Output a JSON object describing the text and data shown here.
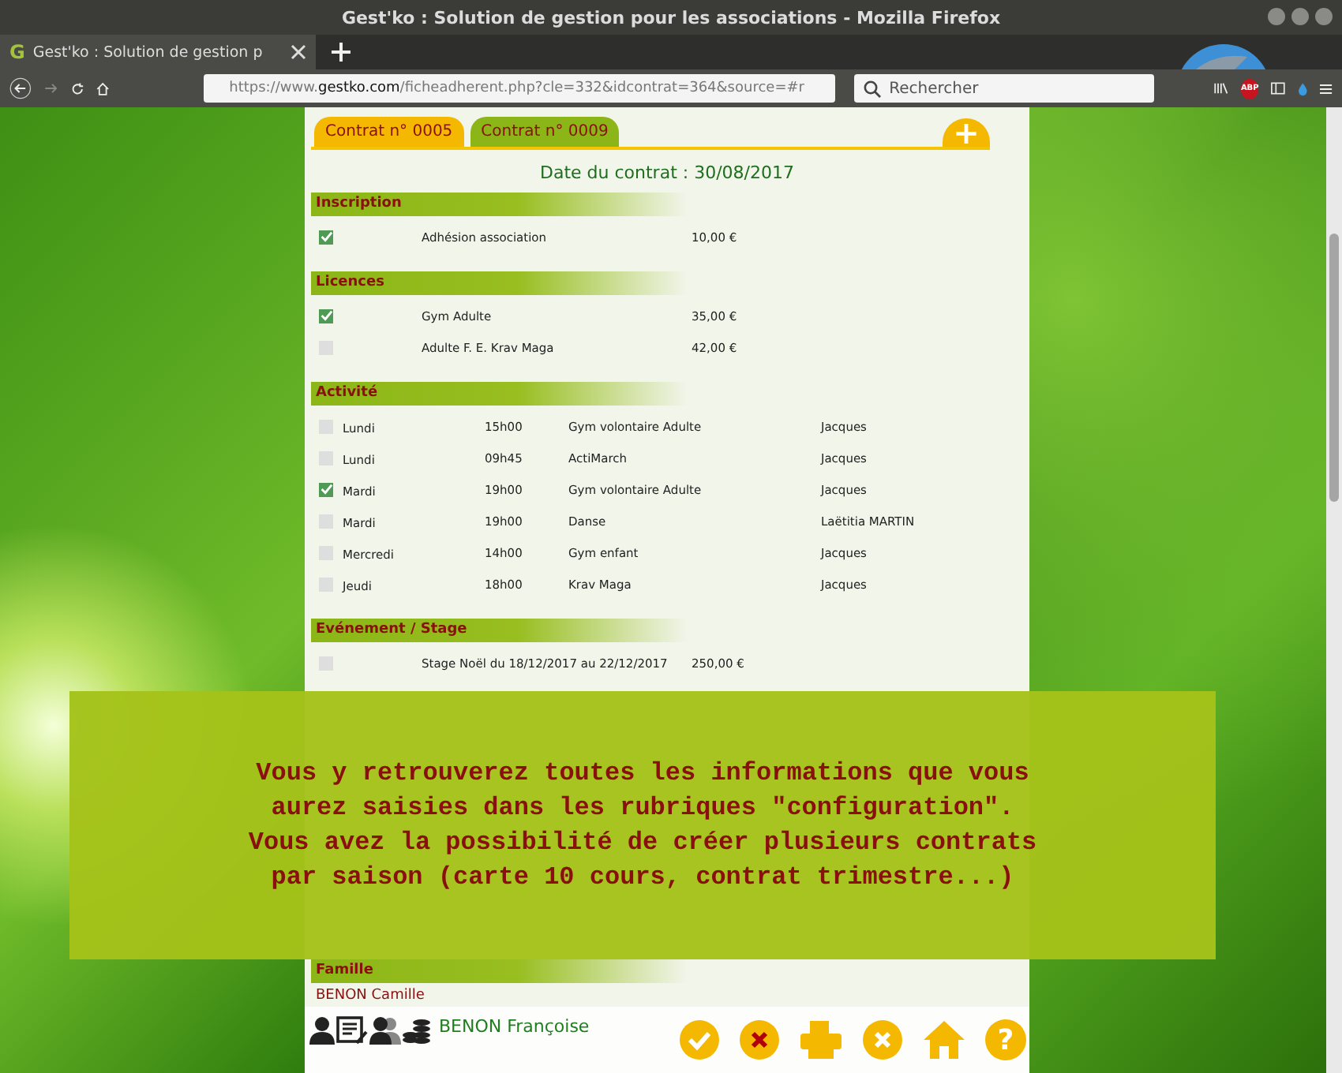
{
  "window": {
    "title": "Gest'ko : Solution de gestion pour les associations - Mozilla Firefox"
  },
  "browser_tab": {
    "favicon": "G",
    "title": "Gest'ko : Solution de gestion p"
  },
  "address_bar": {
    "url_prefix": "https://www.",
    "url_domain": "gestko.com",
    "url_path": "/ficheadherent.php?cle=332&idcontrat=364&source=#r"
  },
  "search": {
    "placeholder": "Rechercher"
  },
  "toolbar_badge": "ABP",
  "contract_tabs": [
    {
      "label": "Contrat n° 0005",
      "selected": true
    },
    {
      "label": "Contrat n° 0009",
      "selected": false
    }
  ],
  "add_contract_button": "+",
  "contract_date": "Date du contrat : 30/08/2017",
  "sections": [
    {
      "title": "Inscription",
      "kind": "simple",
      "rows": [
        {
          "checked": true,
          "label": "Adhésion association",
          "price": "10,00 €"
        }
      ]
    },
    {
      "title": "Licences",
      "kind": "simple",
      "rows": [
        {
          "checked": true,
          "label": "Gym Adulte",
          "price": "35,00 €"
        },
        {
          "checked": false,
          "label": "Adulte F. E. Krav Maga",
          "price": "42,00 €"
        }
      ]
    },
    {
      "title": "Activité",
      "kind": "activity",
      "rows": [
        {
          "checked": false,
          "day": "Lundi",
          "time": "15h00",
          "name": "Gym volontaire Adulte",
          "teacher": "Jacques"
        },
        {
          "checked": false,
          "day": "Lundi",
          "time": "09h45",
          "name": "ActiMarch",
          "teacher": "Jacques"
        },
        {
          "checked": true,
          "day": "Mardi",
          "time": "19h00",
          "name": "Gym volontaire Adulte",
          "teacher": "Jacques"
        },
        {
          "checked": false,
          "day": "Mardi",
          "time": "19h00",
          "name": "Danse",
          "teacher": "Laëtitia MARTIN"
        },
        {
          "checked": false,
          "day": "Mercredi",
          "time": "14h00",
          "name": "Gym enfant",
          "teacher": "Jacques"
        },
        {
          "checked": false,
          "day": "Jeudi",
          "time": "18h00",
          "name": "Krav Maga",
          "teacher": "Jacques"
        }
      ]
    },
    {
      "title": "Evénement / Stage",
      "kind": "simple",
      "rows": [
        {
          "checked": false,
          "label": "Stage Noël du 18/12/2017 au 22/12/2017",
          "price": "250,00 €"
        }
      ]
    }
  ],
  "family": {
    "title": "Famille",
    "members": [
      "BENON Camille"
    ]
  },
  "member_name": "BENON Françoise",
  "help_button": "?",
  "overlay_text": "Vous y retrouverez toutes les informations que vous aurez saisies dans les rubriques \"configuration\". Vous avez la possibilité de créer plusieurs contrats par saison (carte 10 cours, contrat trimestre...)"
}
